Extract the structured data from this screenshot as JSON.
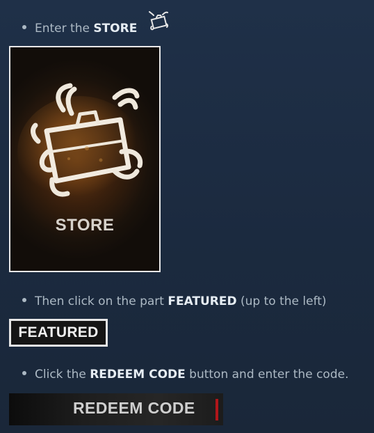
{
  "steps": [
    {
      "text_before": "Enter the ",
      "bold": "STORE",
      "text_after": ""
    },
    {
      "text_before": "Then click on the part ",
      "bold": "FEATURED",
      "text_after": " (up to the left)"
    },
    {
      "text_before": "Click the ",
      "bold": "REDEEM CODE",
      "text_after": " button and enter the code."
    }
  ],
  "store_card": {
    "label": "STORE",
    "icon": "store-briefcase-icon"
  },
  "featured_button": {
    "label": "FEATURED"
  },
  "redeem_button": {
    "label": "REDEEM CODE"
  },
  "colors": {
    "background": "#1b2a3f",
    "text": "#acb9c4",
    "bold_text": "#e6edf3",
    "accent_red": "#b0161a"
  }
}
